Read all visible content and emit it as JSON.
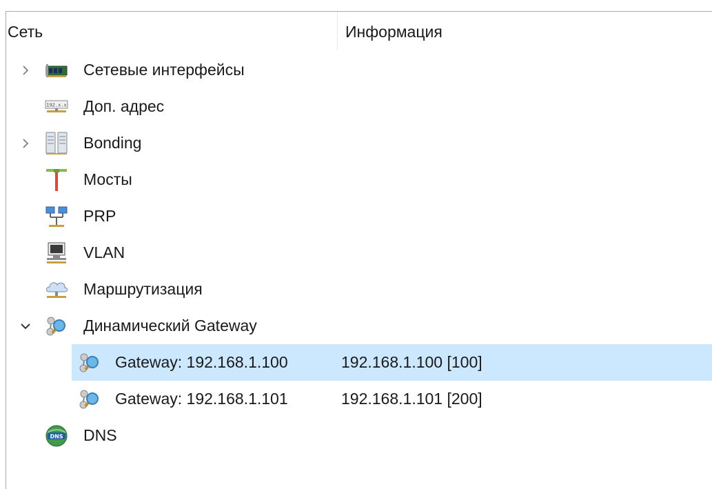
{
  "columns": {
    "name": "Сеть",
    "info": "Информация"
  },
  "tree": [
    {
      "label": "Сетевые интерфейсы",
      "icon": "network-card-icon",
      "expander": "collapsed"
    },
    {
      "label": "Доп. адрес",
      "icon": "ip-address-icon",
      "expander": "none"
    },
    {
      "label": "Bonding",
      "icon": "server-stack-icon",
      "expander": "collapsed"
    },
    {
      "label": "Мосты",
      "icon": "bridge-icon",
      "expander": "none"
    },
    {
      "label": "PRP",
      "icon": "prp-network-icon",
      "expander": "none"
    },
    {
      "label": "VLAN",
      "icon": "vlan-computer-icon",
      "expander": "none"
    },
    {
      "label": "Маршрутизация",
      "icon": "routing-cloud-icon",
      "expander": "none"
    },
    {
      "label": "Динамический Gateway",
      "icon": "gateway-search-icon",
      "expander": "expanded"
    },
    {
      "label": "Gateway: 192.168.1.100",
      "info": "192.168.1.100 [100]",
      "icon": "gateway-search-icon",
      "selected": true
    },
    {
      "label": "Gateway: 192.168.1.101",
      "info": "192.168.1.101 [200]",
      "icon": "gateway-search-icon"
    },
    {
      "label": "DNS",
      "icon": "dns-globe-icon",
      "expander": "none"
    }
  ],
  "icon_text": {
    "ip": "192.x.x",
    "dns": "DNS"
  },
  "colors": {
    "selection": "#cce8ff",
    "border": "#a9a9a9",
    "text": "#1a1a1a"
  }
}
